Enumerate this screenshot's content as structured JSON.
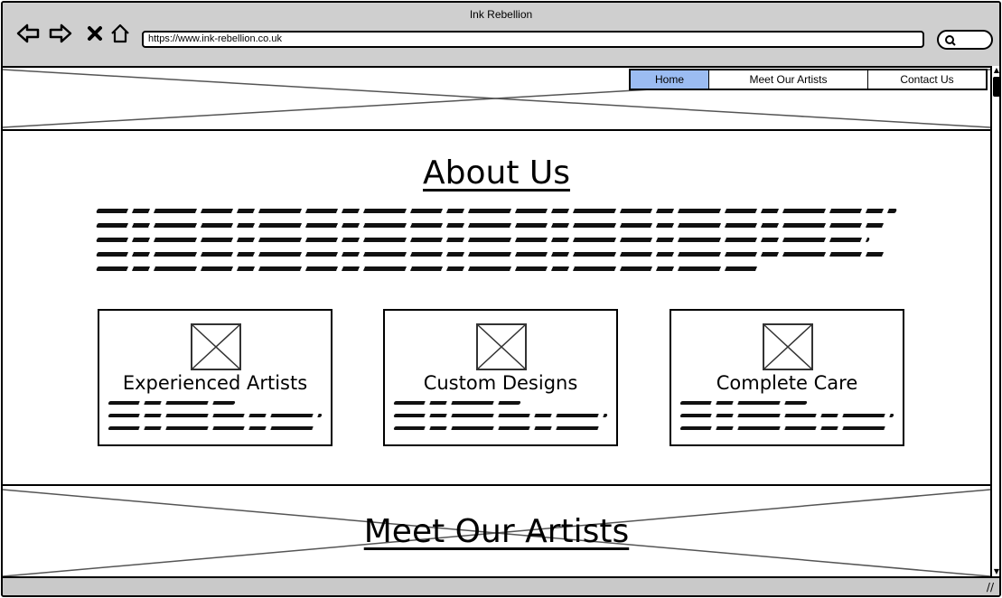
{
  "window": {
    "title": "Ink Rebellion"
  },
  "browser": {
    "url": "https://www.ink-rebellion.co.uk",
    "buttons": {
      "back_icon": "back-arrow-icon",
      "forward_icon": "forward-arrow-icon",
      "stop_icon": "close-icon",
      "home_icon": "home-icon"
    }
  },
  "nav": {
    "tabs": [
      {
        "label": "Home",
        "active": true
      },
      {
        "label": "Meet Our Artists",
        "active": false
      },
      {
        "label": "Contact Us",
        "active": false
      }
    ]
  },
  "about": {
    "title": "About Us",
    "cards": [
      {
        "title": "Experienced Artists"
      },
      {
        "title": "Custom Designs"
      },
      {
        "title": "Complete Care"
      }
    ]
  },
  "artists": {
    "title": "Meet Our Artists"
  },
  "colors": {
    "active_tab": "#9bbcf2",
    "chrome": "#cfcfcf"
  }
}
